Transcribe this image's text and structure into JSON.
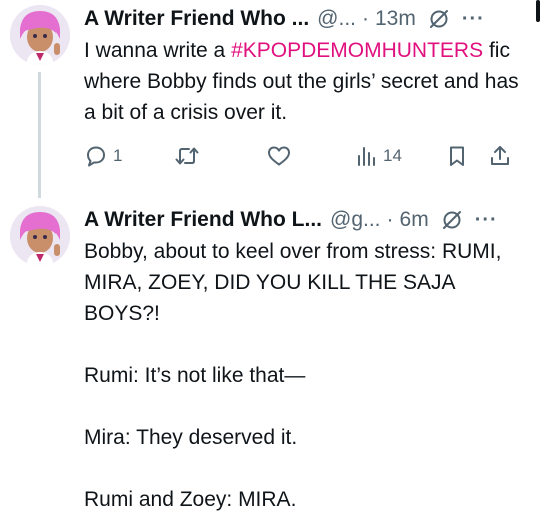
{
  "tweets": [
    {
      "author_name": "A Writer Friend Who ...",
      "handle": "@...",
      "separator": "·",
      "time": "13m",
      "text_before": "I wanna write a ",
      "hashtag": "#KPOPDEMOMHUNTERS",
      "text_after": " fic where Bobby finds out the girls’ secret and has a bit of a crisis over it.",
      "reply_count": "1",
      "views_count": "14"
    },
    {
      "author_name": "A Writer Friend Who L...",
      "handle": "@g...",
      "separator": "·",
      "time": "6m",
      "text": "Bobby, about to keel over from stress: RUMI, MIRA, ZOEY, DID YOU KILL THE SAJA BOYS?!\n\nRumi: It’s not like that—\n\nMira: They deserved it.\n\nRumi and Zoey: MIRA."
    }
  ],
  "icons": {
    "more": "more-icon",
    "grok": "grok-icon",
    "reply": "reply-icon",
    "retweet": "retweet-icon",
    "like": "like-icon",
    "views": "views-icon",
    "bookmark": "bookmark-icon",
    "share": "share-icon"
  },
  "colors": {
    "hashtag": "#e0117f",
    "secondary": "#536471",
    "text": "#0f1419"
  }
}
